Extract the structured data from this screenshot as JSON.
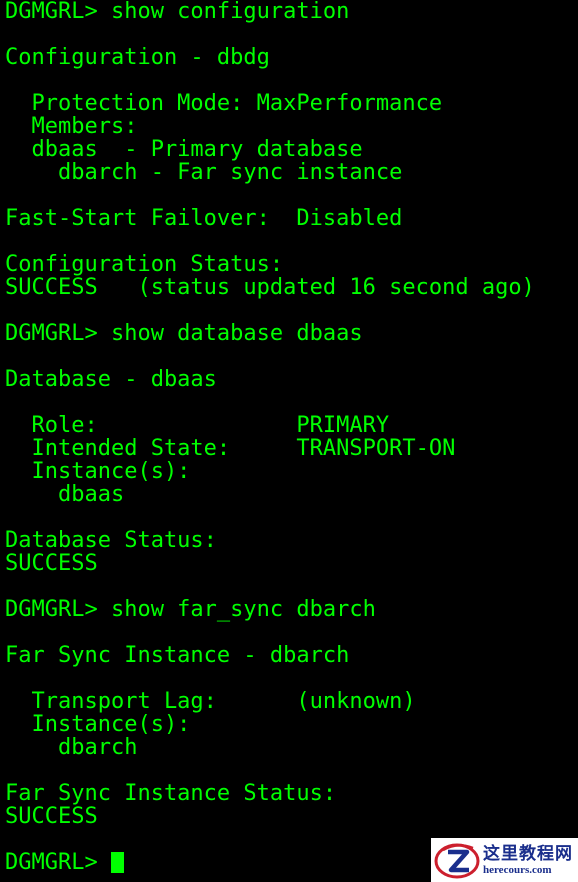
{
  "terminal": {
    "foreground": "#00ff00",
    "background": "#000000",
    "lines": [
      "DGMGRL> show configuration",
      "",
      "Configuration - dbdg",
      "",
      "  Protection Mode: MaxPerformance",
      "  Members:",
      "  dbaas  - Primary database",
      "    dbarch - Far sync instance",
      "",
      "Fast-Start Failover:  Disabled",
      "",
      "Configuration Status:",
      "SUCCESS   (status updated 16 second ago)",
      "",
      "DGMGRL> show database dbaas",
      "",
      "Database - dbaas",
      "",
      "  Role:               PRIMARY",
      "  Intended State:     TRANSPORT-ON",
      "  Instance(s):",
      "    dbaas",
      "",
      "Database Status:",
      "SUCCESS",
      "",
      "DGMGRL> show far_sync dbarch",
      "",
      "Far Sync Instance - dbarch",
      "",
      "  Transport Lag:      (unknown)",
      "  Instance(s):",
      "    dbarch",
      "",
      "Far Sync Instance Status:",
      "SUCCESS",
      "",
      "DGMGRL> "
    ]
  },
  "watermark": {
    "logo_icon": "z-globe-logo-icon",
    "cn_text": "这里教程网",
    "en_text": "herecours.com",
    "color": "#1a2e8c"
  }
}
